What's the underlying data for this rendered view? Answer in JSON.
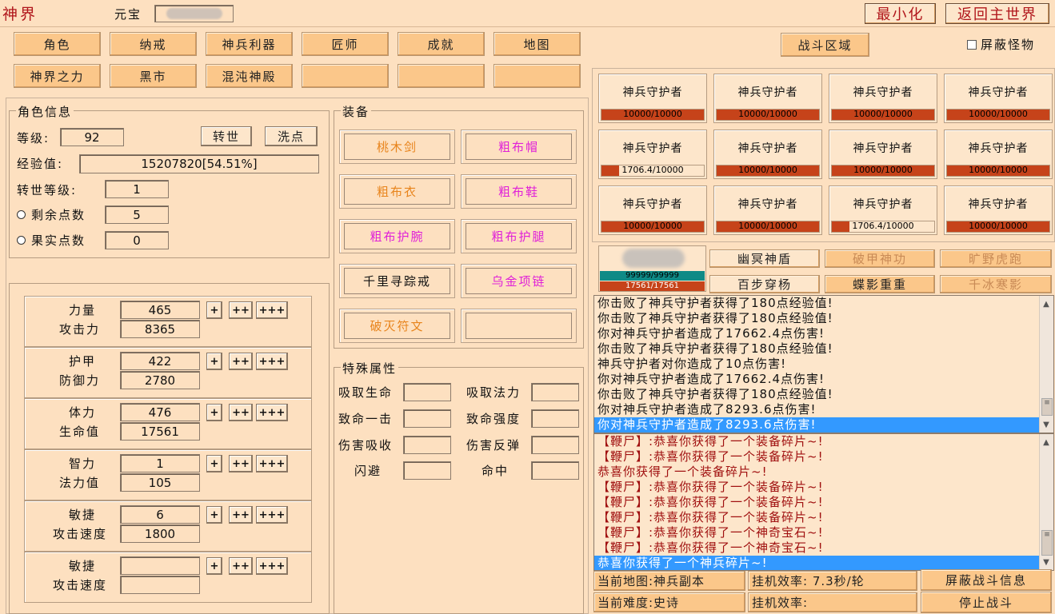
{
  "title": "神界",
  "currency_label": "元宝",
  "window_buttons": {
    "minimize": "最小化",
    "return": "返回主世界"
  },
  "nav_row1": [
    "角色",
    "纳戒",
    "神兵利器",
    "匠师",
    "成就",
    "地图"
  ],
  "nav_row2": [
    "神界之力",
    "黑市",
    "混沌神殿",
    "",
    "",
    ""
  ],
  "battle_area": "战斗区域",
  "hide_monsters": "屏蔽怪物",
  "char_info": {
    "title": "角色信息",
    "level_label": "等级:",
    "level": "92",
    "rebirth_btn": "转世",
    "wash_btn": "洗点",
    "exp_label": "经验值:",
    "exp": "15207820[54.51%]",
    "rebirth_level_label": "转世等级:",
    "rebirth_level": "1",
    "remaining_points_label": "剩余点数",
    "remaining_points": "5",
    "fruit_points_label": "果实点数",
    "fruit_points": "0"
  },
  "stats": [
    {
      "name": "力量",
      "value": "465",
      "sub_name": "攻击力",
      "sub_value": "8365"
    },
    {
      "name": "护甲",
      "value": "422",
      "sub_name": "防御力",
      "sub_value": "2780"
    },
    {
      "name": "体力",
      "value": "476",
      "sub_name": "生命值",
      "sub_value": "17561"
    },
    {
      "name": "智力",
      "value": "1",
      "sub_name": "法力值",
      "sub_value": "105"
    },
    {
      "name": "敏捷",
      "value": "6",
      "sub_name": "攻击速度",
      "sub_value": "1800"
    },
    {
      "name": "敏捷",
      "value": "",
      "sub_name": "攻击速度",
      "sub_value": ""
    }
  ],
  "plus_buttons": [
    "+",
    "++",
    "+++"
  ],
  "equipment": {
    "title": "装备",
    "items": [
      {
        "name": "桃木剑",
        "color": "#e8841c"
      },
      {
        "name": "粗布帽",
        "color": "#e021d8"
      },
      {
        "name": "粗布衣",
        "color": "#e8841c"
      },
      {
        "name": "粗布鞋",
        "color": "#e021d8"
      },
      {
        "name": "粗布护腕",
        "color": "#e021d8"
      },
      {
        "name": "粗布护腿",
        "color": "#e021d8"
      },
      {
        "name": "千里寻踪戒",
        "color": "#111111"
      },
      {
        "name": "乌金项链",
        "color": "#e021d8"
      },
      {
        "name": "破灭符文",
        "color": "#e8841c"
      },
      {
        "name": "",
        "color": "#111111"
      }
    ]
  },
  "special": {
    "title": "特殊属性",
    "labels": [
      "吸取生命",
      "吸取法力",
      "致命一击",
      "致命强度",
      "伤害吸收",
      "伤害反弹",
      "闪避",
      "命中"
    ]
  },
  "monsters": [
    {
      "name": "神兵守护者",
      "hp": "10000/10000",
      "ratio": 1.0
    },
    {
      "name": "神兵守护者",
      "hp": "10000/10000",
      "ratio": 1.0
    },
    {
      "name": "神兵守护者",
      "hp": "10000/10000",
      "ratio": 1.0
    },
    {
      "name": "神兵守护者",
      "hp": "10000/10000",
      "ratio": 1.0
    },
    {
      "name": "神兵守护者",
      "hp": "1706.4/10000",
      "ratio": 0.17
    },
    {
      "name": "神兵守护者",
      "hp": "10000/10000",
      "ratio": 1.0
    },
    {
      "name": "神兵守护者",
      "hp": "10000/10000",
      "ratio": 1.0
    },
    {
      "name": "神兵守护者",
      "hp": "10000/10000",
      "ratio": 1.0
    },
    {
      "name": "神兵守护者",
      "hp": "10000/10000",
      "ratio": 1.0
    },
    {
      "name": "神兵守护者",
      "hp": "10000/10000",
      "ratio": 1.0
    },
    {
      "name": "神兵守护者",
      "hp": "1706.4/10000",
      "ratio": 0.17
    },
    {
      "name": "神兵守护者",
      "hp": "10000/10000",
      "ratio": 1.0
    }
  ],
  "player": {
    "mp": "99999/99999",
    "hp": "17561/17561"
  },
  "skills": [
    {
      "name": "幽冥神盾",
      "enabled": true
    },
    {
      "name": "破甲神功",
      "enabled": false
    },
    {
      "name": "旷野虎跑",
      "enabled": false
    },
    {
      "name": "百步穿杨",
      "enabled": true
    },
    {
      "name": "蝶影重重",
      "enabled": true
    },
    {
      "name": "千冰寒影",
      "enabled": false
    }
  ],
  "battle_log": [
    "你击败了神兵守护者获得了180点经验值!",
    "你击败了神兵守护者获得了180点经验值!",
    "你对神兵守护者造成了17662.4点伤害!",
    "你击败了神兵守护者获得了180点经验值!",
    "神兵守护者对你造成了10点伤害!",
    "你对神兵守护者造成了17662.4点伤害!",
    "你击败了神兵守护者获得了180点经验值!",
    "你对神兵守护者造成了8293.6点伤害!",
    "你对神兵守护者造成了8293.6点伤害!"
  ],
  "loot_log": [
    "【鞭尸】:恭喜你获得了一个装备碎片~!",
    "【鞭尸】:恭喜你获得了一个装备碎片~!",
    "恭喜你获得了一个装备碎片~!",
    "【鞭尸】:恭喜你获得了一个装备碎片~!",
    "【鞭尸】:恭喜你获得了一个装备碎片~!",
    "【鞭尸】:恭喜你获得了一个装备碎片~!",
    "【鞭尸】:恭喜你获得了一个神奇宝石~!",
    "【鞭尸】:恭喜你获得了一个神奇宝石~!",
    "恭喜你获得了一个神兵碎片~!"
  ],
  "footer": {
    "map": "当前地图:神兵副本",
    "efficiency1": "挂机效率: 7.3秒/轮",
    "hide_battle_info": "屏蔽战斗信息",
    "difficulty": "当前难度:史诗",
    "efficiency2": "挂机效率:",
    "stop_battle": "停止战斗"
  }
}
